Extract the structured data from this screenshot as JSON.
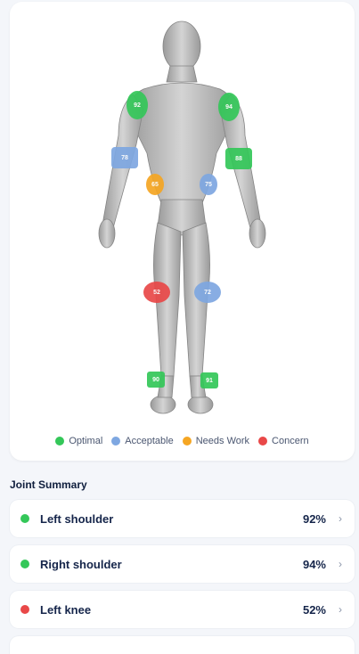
{
  "colors": {
    "optimal": "#34c759",
    "acceptable": "#7ea7e1",
    "needs_work": "#f5a623",
    "concern": "#e94848"
  },
  "markers": [
    {
      "id": "left-shoulder",
      "value": "92",
      "status": "optimal"
    },
    {
      "id": "right-shoulder",
      "value": "94",
      "status": "optimal"
    },
    {
      "id": "left-elbow",
      "value": "78",
      "status": "acceptable"
    },
    {
      "id": "right-elbow",
      "value": "88",
      "status": "optimal"
    },
    {
      "id": "left-hip",
      "value": "65",
      "status": "needs_work"
    },
    {
      "id": "right-hip",
      "value": "75",
      "status": "acceptable"
    },
    {
      "id": "left-knee",
      "value": "52",
      "status": "concern"
    },
    {
      "id": "right-knee",
      "value": "72",
      "status": "acceptable"
    },
    {
      "id": "left-ankle",
      "value": "90",
      "status": "optimal"
    },
    {
      "id": "right-ankle",
      "value": "91",
      "status": "optimal"
    }
  ],
  "legend": {
    "optimal": "Optimal",
    "acceptable": "Acceptable",
    "needs_work": "Needs Work",
    "concern": "Concern"
  },
  "summary": {
    "title": "Joint Summary",
    "rows": [
      {
        "name": "Left shoulder",
        "value": "92%",
        "status": "optimal"
      },
      {
        "name": "Right shoulder",
        "value": "94%",
        "status": "optimal"
      },
      {
        "name": "Left knee",
        "value": "52%",
        "status": "concern"
      }
    ]
  }
}
